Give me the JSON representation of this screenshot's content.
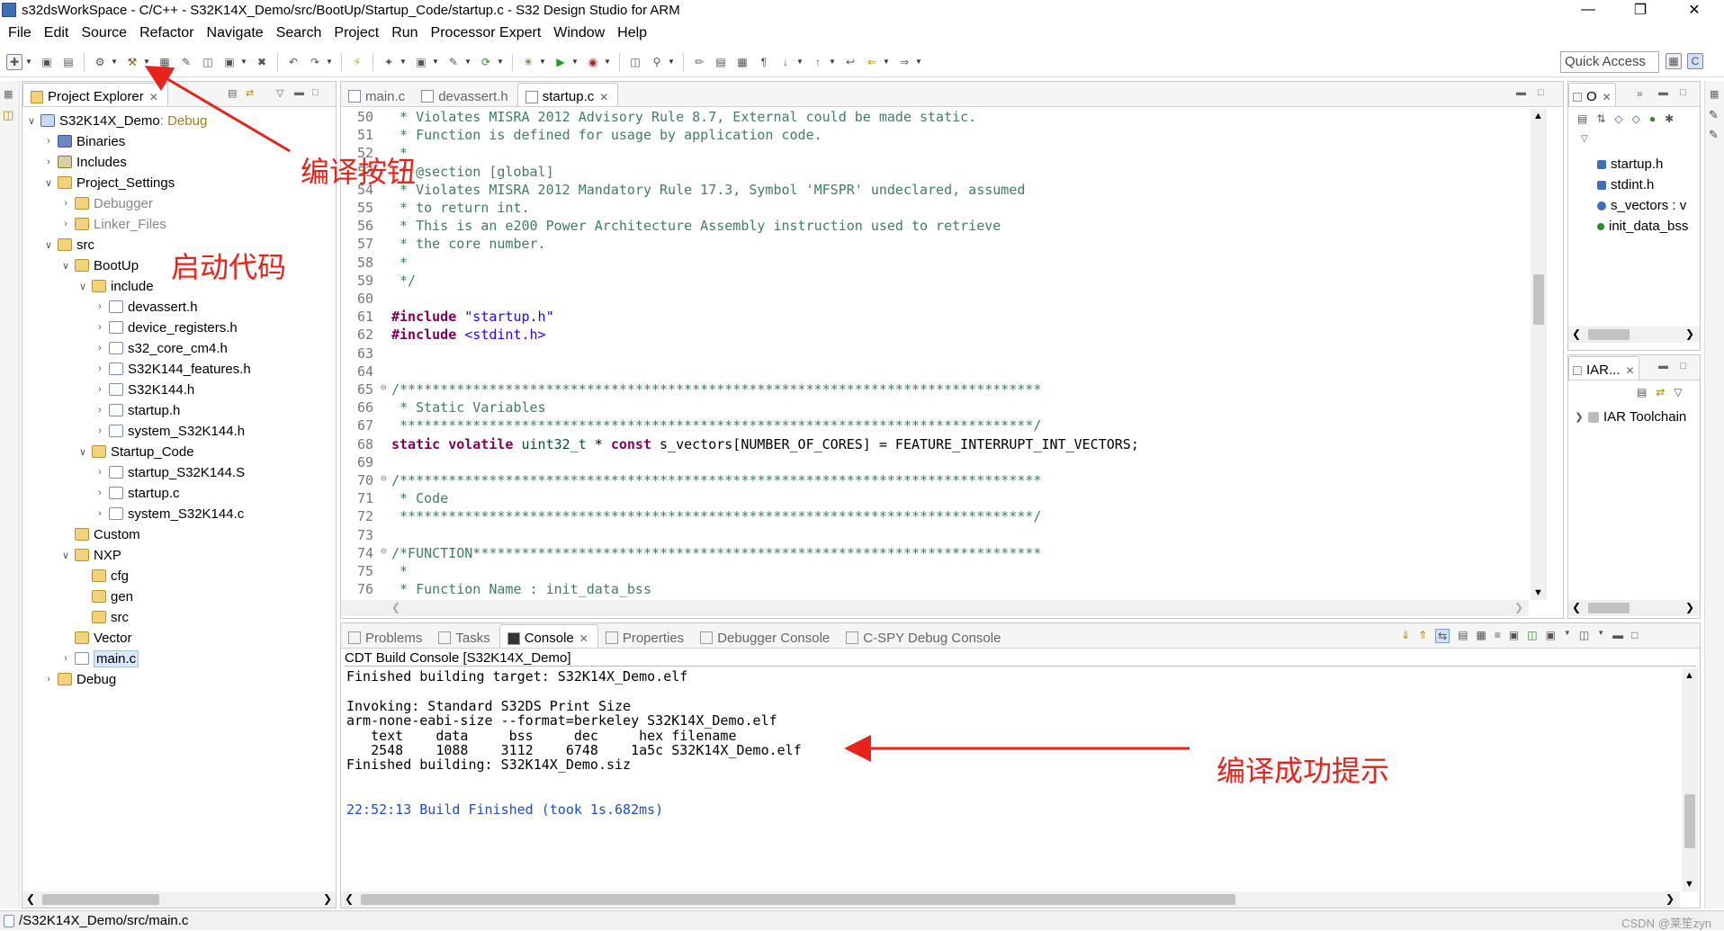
{
  "window": {
    "title": "s32dsWorkSpace - C/C++ - S32K14X_Demo/src/BootUp/Startup_Code/startup.c - S32 Design Studio for ARM"
  },
  "menu": [
    "File",
    "Edit",
    "Source",
    "Refactor",
    "Navigate",
    "Search",
    "Project",
    "Run",
    "Processor Expert",
    "Window",
    "Help"
  ],
  "quick_access": "Quick Access",
  "explorer": {
    "tab": "Project Explorer",
    "tree": [
      {
        "label": "S32K14X_Demo",
        "suffix": ": Debug",
        "level": 0,
        "open": true,
        "icon": "proj"
      },
      {
        "label": "Binaries",
        "level": 1,
        "open": false,
        "icon": "bin"
      },
      {
        "label": "Includes",
        "level": 1,
        "open": false,
        "icon": "inc"
      },
      {
        "label": "Project_Settings",
        "level": 1,
        "open": true,
        "icon": "folder"
      },
      {
        "label": "Debugger",
        "level": 2,
        "open": false,
        "icon": "folder",
        "dim": true
      },
      {
        "label": "Linker_Files",
        "level": 2,
        "open": false,
        "icon": "folder",
        "dim": true
      },
      {
        "label": "src",
        "level": 1,
        "open": true,
        "icon": "folder"
      },
      {
        "label": "BootUp",
        "level": 2,
        "open": true,
        "icon": "folder"
      },
      {
        "label": "include",
        "level": 3,
        "open": true,
        "icon": "folder"
      },
      {
        "label": "devassert.h",
        "level": 4,
        "open": false,
        "icon": "file"
      },
      {
        "label": "device_registers.h",
        "level": 4,
        "open": false,
        "icon": "file"
      },
      {
        "label": "s32_core_cm4.h",
        "level": 4,
        "open": false,
        "icon": "file"
      },
      {
        "label": "S32K144_features.h",
        "level": 4,
        "open": false,
        "icon": "file"
      },
      {
        "label": "S32K144.h",
        "level": 4,
        "open": false,
        "icon": "file"
      },
      {
        "label": "startup.h",
        "level": 4,
        "open": false,
        "icon": "file"
      },
      {
        "label": "system_S32K144.h",
        "level": 4,
        "open": false,
        "icon": "file"
      },
      {
        "label": "Startup_Code",
        "level": 3,
        "open": true,
        "icon": "folder"
      },
      {
        "label": "startup_S32K144.S",
        "level": 4,
        "open": false,
        "icon": "file"
      },
      {
        "label": "startup.c",
        "level": 4,
        "open": false,
        "icon": "file"
      },
      {
        "label": "system_S32K144.c",
        "level": 4,
        "open": false,
        "icon": "file"
      },
      {
        "label": "Custom",
        "level": 2,
        "open": null,
        "icon": "folder"
      },
      {
        "label": "NXP",
        "level": 2,
        "open": true,
        "icon": "folder"
      },
      {
        "label": "cfg",
        "level": 3,
        "open": null,
        "icon": "folder"
      },
      {
        "label": "gen",
        "level": 3,
        "open": null,
        "icon": "folder"
      },
      {
        "label": "src",
        "level": 3,
        "open": null,
        "icon": "folder"
      },
      {
        "label": "Vector",
        "level": 2,
        "open": null,
        "icon": "folder"
      },
      {
        "label": "main.c",
        "level": 2,
        "open": false,
        "icon": "file",
        "selected": true
      },
      {
        "label": "Debug",
        "level": 1,
        "open": false,
        "icon": "folder"
      }
    ]
  },
  "editor": {
    "tabs": [
      {
        "label": "main.c",
        "active": false
      },
      {
        "label": "devassert.h",
        "active": false
      },
      {
        "label": "startup.c",
        "active": true
      }
    ],
    "lines": [
      {
        "n": "50",
        "t": " * Violates MISRA 2012 Advisory Rule 8.7, External could be made static.",
        "k": "cm"
      },
      {
        "n": "51",
        "t": " * Function is defined for usage by application code.",
        "k": "cm"
      },
      {
        "n": "52",
        "t": " *",
        "k": "cm"
      },
      {
        "n": "53",
        "t": " * @section [global]",
        "k": "cm"
      },
      {
        "n": "54",
        "t": " * Violates MISRA 2012 Mandatory Rule 17.3, Symbol 'MFSPR' undeclared, assumed",
        "k": "cm"
      },
      {
        "n": "55",
        "t": " * to return int.",
        "k": "cm"
      },
      {
        "n": "56",
        "t": " * This is an e200 Power Architecture Assembly instruction used to retrieve",
        "k": "cm"
      },
      {
        "n": "57",
        "t": " * the core number.",
        "k": "cm"
      },
      {
        "n": "58",
        "t": " *",
        "k": "cm"
      },
      {
        "n": "59",
        "t": " */",
        "k": "cm"
      },
      {
        "n": "60",
        "t": "",
        "k": "cm"
      },
      {
        "n": "61",
        "t": "#include \"startup.h\"",
        "k": "inc"
      },
      {
        "n": "62",
        "t": "#include <stdint.h>",
        "k": "inc"
      },
      {
        "n": "63",
        "t": "",
        "k": "cm"
      },
      {
        "n": "64",
        "t": "",
        "k": "cm"
      },
      {
        "n": "65",
        "t": "/*******************************************************************************",
        "k": "cm",
        "fold": true
      },
      {
        "n": "66",
        "t": " * Static Variables",
        "k": "cm"
      },
      {
        "n": "67",
        "t": " ******************************************************************************/",
        "k": "cm"
      },
      {
        "n": "68",
        "t": "static volatile uint32_t * const s_vectors[NUMBER_OF_CORES] = FEATURE_INTERRUPT_INT_VECTORS;",
        "k": "decl"
      },
      {
        "n": "69",
        "t": "",
        "k": "cm"
      },
      {
        "n": "70",
        "t": "/*******************************************************************************",
        "k": "cm",
        "fold": true
      },
      {
        "n": "71",
        "t": " * Code",
        "k": "cm"
      },
      {
        "n": "72",
        "t": " ******************************************************************************/",
        "k": "cm"
      },
      {
        "n": "73",
        "t": "",
        "k": "cm"
      },
      {
        "n": "74",
        "t": "/*FUNCTION**********************************************************************",
        "k": "cm",
        "fold": true
      },
      {
        "n": "75",
        "t": " *",
        "k": "cm"
      },
      {
        "n": "76",
        "t": " * Function Name : init_data_bss",
        "k": "cm"
      }
    ]
  },
  "outline": {
    "tab": "O",
    "items": [
      "startup.h",
      "stdint.h",
      "s_vectors : v",
      "init_data_bss"
    ]
  },
  "iar": {
    "tab": "IAR...",
    "item": "IAR Toolchain"
  },
  "console": {
    "tabs": [
      {
        "label": "Problems",
        "active": false
      },
      {
        "label": "Tasks",
        "active": false
      },
      {
        "label": "Console",
        "active": true
      },
      {
        "label": "Properties",
        "active": false
      },
      {
        "label": "Debugger Console",
        "active": false
      },
      {
        "label": "C-SPY Debug Console",
        "active": false
      }
    ],
    "header": "CDT Build Console [S32K14X_Demo]",
    "lines": [
      "Finished building target: S32K14X_Demo.elf",
      "",
      "Invoking: Standard S32DS Print Size",
      "arm-none-eabi-size --format=berkeley S32K14X_Demo.elf",
      "   text\t   data\t    bss\t    dec\t    hex\tfilename",
      "   2548\t   1088\t   3112\t   6748\t   1a5c\tS32K14X_Demo.elf",
      "Finished building: S32K14X_Demo.siz",
      "",
      "",
      "22:52:13 Build Finished (took 1s.682ms)"
    ]
  },
  "status": {
    "path": "/S32K14X_Demo/src/main.c",
    "watermark": "CSDN @莱笙zyn"
  },
  "annotations": {
    "build_button": "编译按钮",
    "startup_code": "启动代码",
    "build_success": "编译成功提示"
  },
  "colors": {
    "annotation": "#e8231b",
    "comment": "#3f7f5f",
    "keyword": "#7f0055",
    "string": "#2a00ff",
    "build_finished": "#1a4fc7"
  }
}
